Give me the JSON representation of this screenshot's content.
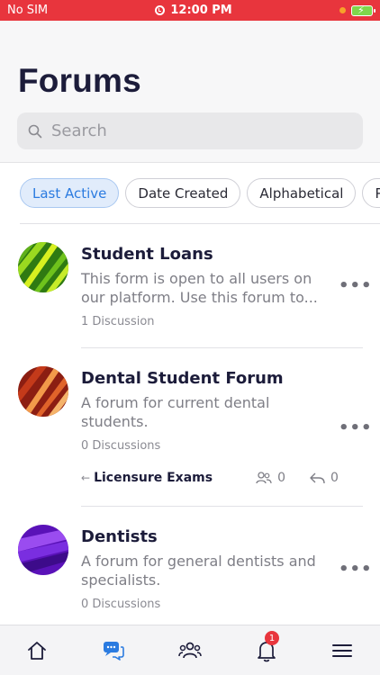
{
  "status_bar": {
    "carrier": "No SIM",
    "time": "12:00 PM",
    "colors": {
      "bar": "#e8353d",
      "battery": "#7fd64b"
    }
  },
  "page": {
    "title": "Forums"
  },
  "search": {
    "placeholder": "Search"
  },
  "filters": [
    {
      "label": "Last Active",
      "active": true
    },
    {
      "label": "Date Created",
      "active": false
    },
    {
      "label": "Alphabetical",
      "active": false
    },
    {
      "label": "P",
      "active": false
    }
  ],
  "forums": [
    {
      "name": "Student Loans",
      "description": "This form is open to all users on our platform. Use this forum to...",
      "count": "1 Discussion",
      "avatar_icon": "green-stripes-avatar"
    },
    {
      "name": "Dental Student Forum",
      "description": "A forum for current dental students.",
      "count": "0 Discussions",
      "avatar_icon": "orange-stripes-avatar",
      "subforum": {
        "label": "Licensure Exams",
        "members": "0",
        "replies": "0"
      }
    },
    {
      "name": "Dentists",
      "description": "A forum for general dentists and specialists.",
      "count": "0 Discussions",
      "avatar_icon": "purple-stripes-avatar"
    }
  ],
  "tabbar": {
    "items": [
      "home-icon",
      "forums-chat-icon",
      "groups-icon",
      "notifications-bell-icon",
      "menu-icon"
    ],
    "notification_badge": "1",
    "colors": {
      "active": "#2b7be0",
      "inactive": "#1c1c3a"
    }
  }
}
